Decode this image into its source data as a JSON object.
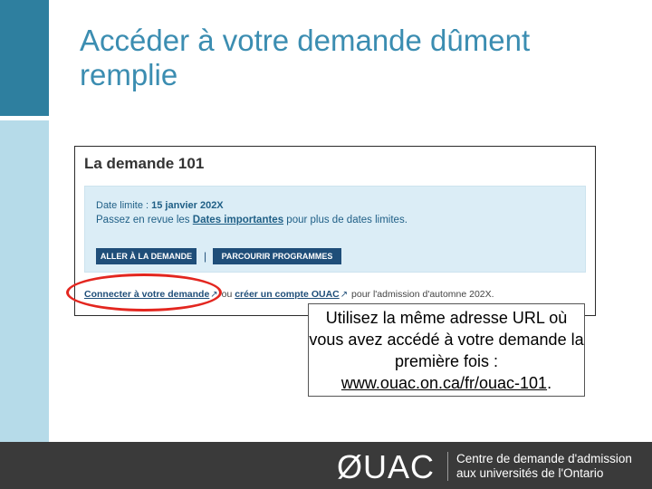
{
  "slide": {
    "title": "Accéder à votre demande dûment remplie"
  },
  "screenshot": {
    "heading": "La demande 101",
    "deadline_label": "Date limite : ",
    "deadline_value": "15 janvier 202X",
    "review_prefix": "Passez en revue les ",
    "review_link": "Dates importantes",
    "review_suffix": " pour plus de dates limites.",
    "button_application": "ALLER À LA DEMANDE",
    "separator": "|",
    "button_programs": "PARCOURIR PROGRAMMES",
    "connect_link": "Connecter à votre demande",
    "connect_or": " ou ",
    "create_link": "créer un compte OUAC",
    "connect_suffix": " pour l'admission d'automne 202X."
  },
  "callout": {
    "text": "Utilisez la même adresse URL où vous avez accédé à votre demande la première fois : ",
    "url": "www.ouac.on.ca/fr/ouac-101",
    "end": "."
  },
  "footer": {
    "logo": "ØUAC",
    "line1": "Centre de demande d'admission",
    "line2": "aux universités de l'Ontario"
  },
  "colors": {
    "title": "#3b8db1",
    "sidebar_dark": "#2e7f9f",
    "sidebar_light": "#b6dbe9",
    "button": "#1f4e79",
    "highlight": "#e3261f",
    "footer": "#3a3a3a"
  },
  "icons": {
    "external_link": "external-link-icon"
  }
}
